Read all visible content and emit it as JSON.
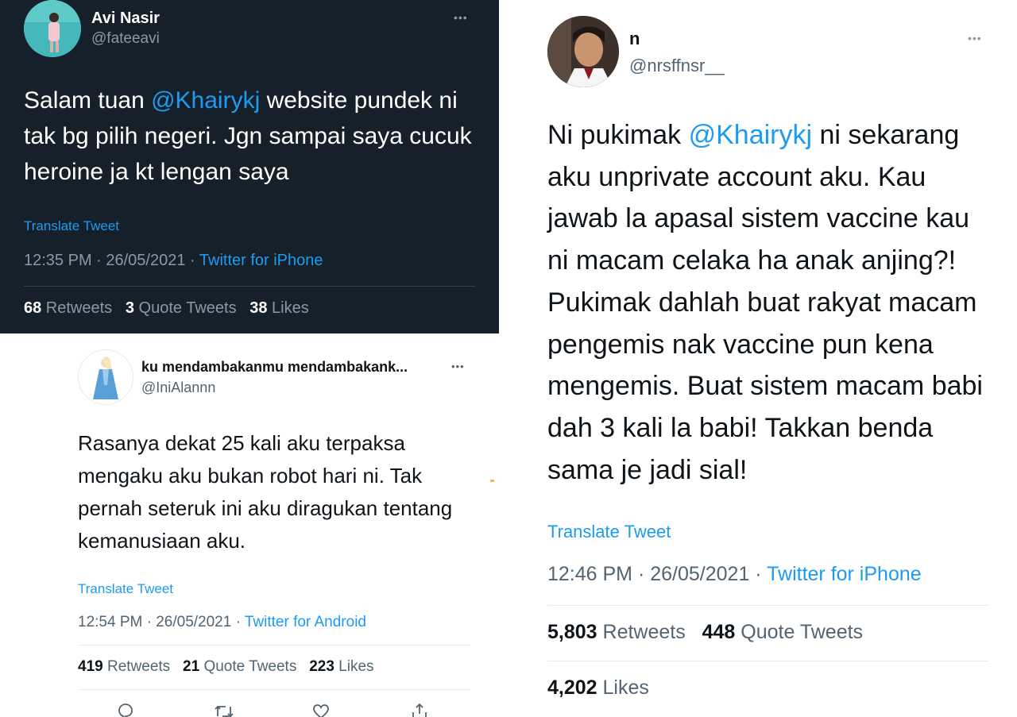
{
  "tweet1": {
    "name": "Avi Nasir",
    "handle": "@fateeavi",
    "more": "•••",
    "text_before": "Salam tuan ",
    "mention": "@Khairykj",
    "text_after": " website pundek ni tak bg pilih negeri. Jgn sampai saya cucuk heroine ja kt lengan saya",
    "translate": "Translate Tweet",
    "time": "12:35 PM · 26/05/2021 · ",
    "source": "Twitter for iPhone",
    "retweets": "68",
    "retweets_label": " Retweets",
    "quotes": "3",
    "quotes_label": " Quote Tweets",
    "likes": "38",
    "likes_label": " Likes"
  },
  "tweet2": {
    "name": "ku mendambakanmu mendambakank...",
    "handle": "@IniAlannn",
    "more": "•••",
    "text": "Rasanya dekat 25 kali aku terpaksa mengaku aku bukan robot hari ni. Tak pernah seteruk ini aku diragukan tentang kemanusiaan aku.",
    "translate": "Translate Tweet",
    "time": "12:54 PM · 26/05/2021 · ",
    "source": "Twitter for Android",
    "retweets": "419",
    "retweets_label": " Retweets",
    "quotes": "21",
    "quotes_label": " Quote Tweets",
    "likes": "223",
    "likes_label": " Likes",
    "actions": [
      "reply-icon",
      "retweet-icon",
      "like-icon",
      "share-icon"
    ]
  },
  "tweet3": {
    "name": "n",
    "handle": "@nrsffnsr__",
    "more": "•••",
    "text_before": "Ni pukimak ",
    "mention": "@Khairykj",
    "text_after": " ni sekarang aku unprivate account aku. Kau jawab la apasal sistem vaccine kau ni macam celaka ha anak anjing?! Pukimak dahlah buat rakyat macam pengemis nak vaccine pun kena mengemis. Buat sistem macam babi dah 3 kali la babi! Takkan benda sama je jadi sial!",
    "translate": "Translate Tweet",
    "time": "12:46 PM · 26/05/2021 · ",
    "source": "Twitter for iPhone",
    "retweets": "5,803",
    "retweets_label": " Retweets",
    "quotes": "448",
    "quotes_label": " Quote Tweets",
    "likes": "4,202",
    "likes_label": " Likes"
  },
  "colors": {
    "dark_bg": "#15202b",
    "accent": "#1d9bf0",
    "dark_secondary": "#8b98a5",
    "light_secondary": "#536471"
  }
}
